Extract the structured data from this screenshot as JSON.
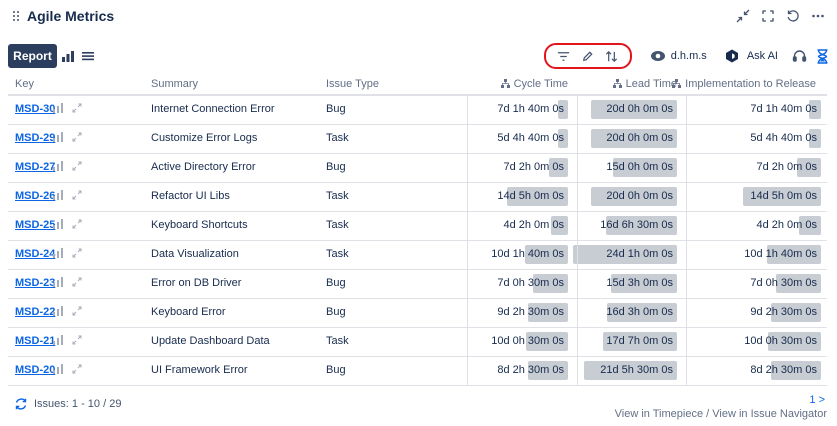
{
  "app": {
    "title": "Agile Metrics"
  },
  "toolbar": {
    "report_label": "Report",
    "time_format_label": "d.h.m.s",
    "ask_ai_label": "Ask AI"
  },
  "table": {
    "columns": {
      "key": "Key",
      "summary": "Summary",
      "issue_type": "Issue Type",
      "cycle_time": "Cycle Time",
      "lead_time": "Lead Time",
      "impl_release": "Implementation to Release"
    },
    "rows": [
      {
        "key": "MSD-30",
        "summary": "Internet Connection Error",
        "type": "Bug",
        "cycle": "7d 1h 40m 0s",
        "cycle_frac": 0.09,
        "lead": "20d 0h 0m 0s",
        "lead_frac": 0.83,
        "impl": "7d 1h 40m 0s",
        "impl_frac": 0.09
      },
      {
        "key": "MSD-29",
        "summary": "Customize Error Logs",
        "type": "Task",
        "cycle": "5d 4h 40m 0s",
        "cycle_frac": 0.09,
        "lead": "20d 0h 0m 0s",
        "lead_frac": 0.83,
        "impl": "5d 4h 40m 0s",
        "impl_frac": 0.09
      },
      {
        "key": "MSD-27",
        "summary": "Active Directory Error",
        "type": "Bug",
        "cycle": "7d 2h 0m 0s",
        "cycle_frac": 0.18,
        "lead": "15d 0h 0m 0s",
        "lead_frac": 0.62,
        "impl": "7d 2h 0m 0s",
        "impl_frac": 0.18
      },
      {
        "key": "MSD-26",
        "summary": "Refactor UI Libs",
        "type": "Task",
        "cycle": "14d 5h 0m 0s",
        "cycle_frac": 0.57,
        "lead": "20d 0h 0m 0s",
        "lead_frac": 0.83,
        "impl": "14d 5h 0m 0s",
        "impl_frac": 0.57
      },
      {
        "key": "MSD-25",
        "summary": "Keyboard Shortcuts",
        "type": "Task",
        "cycle": "4d 2h 0m 0s",
        "cycle_frac": 0.16,
        "lead": "16d 6h 30m 0s",
        "lead_frac": 0.68,
        "impl": "4d 2h 0m 0s",
        "impl_frac": 0.16
      },
      {
        "key": "MSD-24",
        "summary": "Data Visualization",
        "type": "Task",
        "cycle": "10d 1h 40m 0s",
        "cycle_frac": 0.4,
        "lead": "24d 1h 0m 0s",
        "lead_frac": 1.0,
        "impl": "10d 1h 40m 0s",
        "impl_frac": 0.4
      },
      {
        "key": "MSD-23",
        "summary": "Error on DB Driver",
        "type": "Bug",
        "cycle": "7d 0h 30m 0s",
        "cycle_frac": 0.33,
        "lead": "15d 3h 0m 0s",
        "lead_frac": 0.63,
        "impl": "7d 0h 30m 0s",
        "impl_frac": 0.33
      },
      {
        "key": "MSD-22",
        "summary": "Keyboard Error",
        "type": "Bug",
        "cycle": "9d 2h 30m 0s",
        "cycle_frac": 0.37,
        "lead": "16d 3h 0m 0s",
        "lead_frac": 0.67,
        "impl": "9d 2h 30m 0s",
        "impl_frac": 0.37
      },
      {
        "key": "MSD-21",
        "summary": "Update Dashboard Data",
        "type": "Task",
        "cycle": "10d 0h 30m 0s",
        "cycle_frac": 0.39,
        "lead": "17d 7h 0m 0s",
        "lead_frac": 0.71,
        "impl": "10d 0h 30m 0s",
        "impl_frac": 0.39
      },
      {
        "key": "MSD-20",
        "summary": "UI Framework Error",
        "type": "Bug",
        "cycle": "8d 2h 30m 0s",
        "cycle_frac": 0.37,
        "lead": "21d 5h 30m 0s",
        "lead_frac": 0.89,
        "impl": "8d 2h 30m 0s",
        "impl_frac": 0.37
      }
    ]
  },
  "footer": {
    "issues_label": "Issues: 1 - 10 / 29",
    "pager_label": "1 >",
    "timepiece_link": "View in Timepiece",
    "separator": " / ",
    "navigator_link": "View in Issue Navigator"
  },
  "colors": {
    "accent": "#0c66e4",
    "bar": "#c8ccd3",
    "report_button": "#2c3e5d",
    "highlight": "#e2141c"
  }
}
